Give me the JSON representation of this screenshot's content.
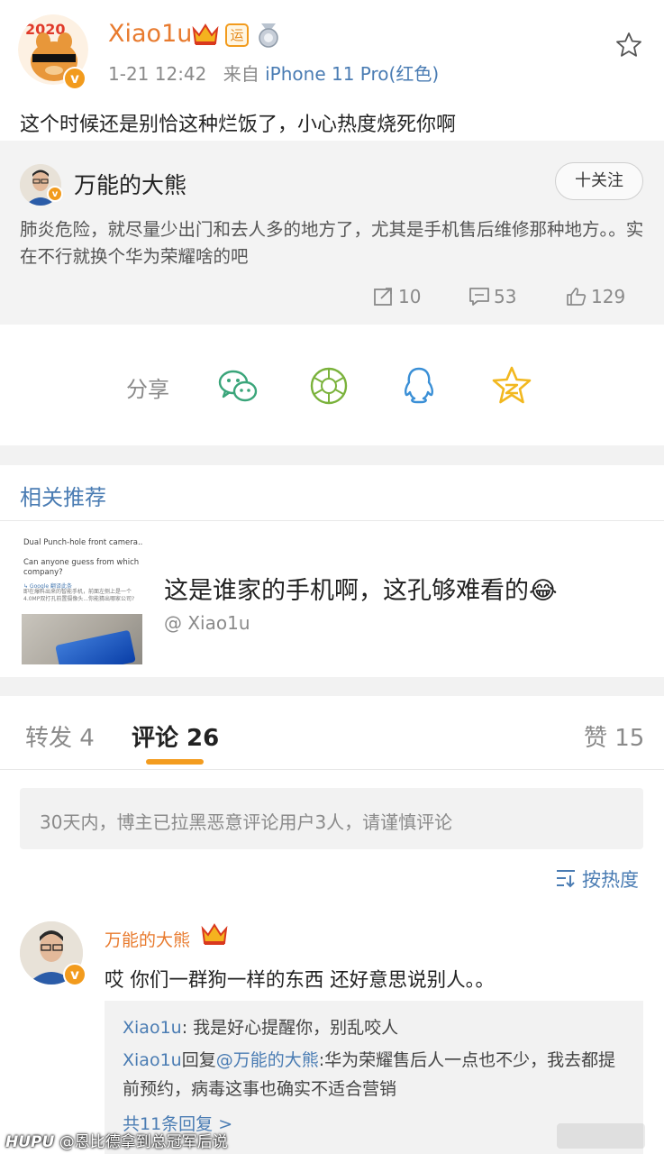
{
  "post": {
    "username": "Xiao1u",
    "badge_yun": "运",
    "time": "1-21 12:42",
    "source_prefix": "来自",
    "source_device": "iPhone 11 Pro(红色)",
    "text": "这个时候还是别恰这种烂饭了，小心热度烧死你啊",
    "verified_badge": "v"
  },
  "quote": {
    "username": "万能的大熊",
    "follow_label": "十关注",
    "text": "肺炎危险，就尽量少出门和去人多的地方了，尤其是手机售后维修那种地方。。实在不行就换个华为荣耀啥的吧",
    "reposts": "10",
    "comments": "53",
    "likes": "129"
  },
  "share": {
    "label": "分享",
    "icons": [
      "wechat-icon",
      "moments-icon",
      "qq-icon",
      "qzone-icon"
    ]
  },
  "related": {
    "title": "相关推荐",
    "thumb_title": "Dual Punch-hole front camera...",
    "thumb_question": "Can anyone guess from which company?",
    "thumb_source": "↳ Google 翻译此条",
    "thumb_translation": "即在爆料出来的智能手机，前面左侧上是一个4.0MP双打孔前置摄像头...你能猜出哪家公司?",
    "headline": "这是谁家的手机啊，这孔够难看的😂",
    "author": "@ Xiao1u"
  },
  "tabs": {
    "repost": "转发 4",
    "comment": "评论 26",
    "like": "赞 15"
  },
  "notice": "30天内，博主已拉黑恶意评论用户3人，请谨慎评论",
  "sort_label": "按热度",
  "comment": {
    "username": "万能的大熊",
    "text": "哎 你们一群狗一样的东西 还好意思说别人。。",
    "replies": [
      {
        "name": "Xiao1u",
        "text": ": 我是好心提醒你，别乱咬人"
      },
      {
        "name": "Xiao1u",
        "mid": "回复",
        "target": "@万能的大熊",
        "text": ":华为荣耀售后人一点也不少，我去都提前预约，病毒这事也确实不适合营销"
      }
    ],
    "more": "共11条回复 >"
  },
  "watermark": {
    "brand": "HUPU",
    "text": "@恩比德拿到总冠军后说"
  },
  "colors": {
    "accent_orange": "#e87b2f",
    "link_blue": "#4a7cb3",
    "tab_underline": "#f39c1f"
  }
}
